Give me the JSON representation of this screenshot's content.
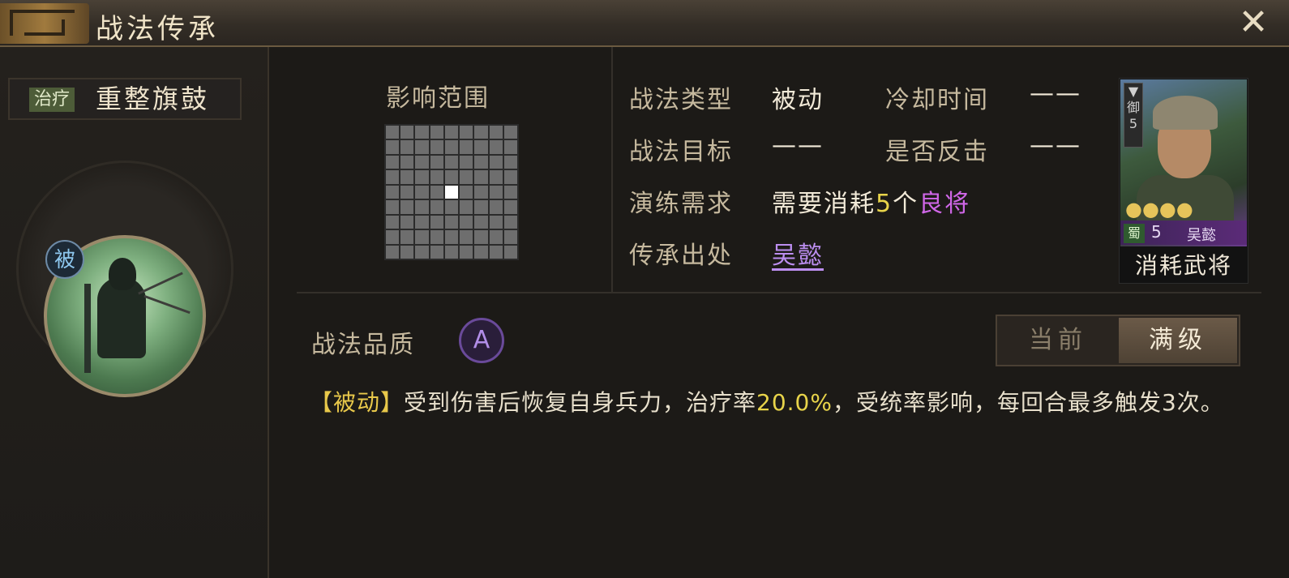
{
  "header": {
    "title": "战法传承",
    "close_icon": "close-icon"
  },
  "skill": {
    "tag": "治疗",
    "name": "重整旗鼓",
    "badge": "被"
  },
  "range": {
    "label": "影响范围",
    "grid_rows": 9,
    "grid_cols": 9,
    "highlight_row": 4,
    "highlight_col": 4
  },
  "info": {
    "type_label": "战法类型",
    "type_value": "被动",
    "cooldown_label": "冷却时间",
    "cooldown_value": "——",
    "target_label": "战法目标",
    "target_value": "——",
    "counter_label": "是否反击",
    "counter_value": "——",
    "req_label": "演练需求",
    "req_prefix": "需要消耗",
    "req_count": "5",
    "req_unit": "个",
    "req_item": "良将",
    "origin_label": "传承出处",
    "origin_value": "吴懿"
  },
  "card": {
    "rank_char": "御",
    "rank_num": "5",
    "stars": "CCCC",
    "faction": "蜀",
    "cost": "5",
    "name": "吴懿",
    "caption": "消耗武将"
  },
  "quality": {
    "label": "战法品质",
    "grade": "A"
  },
  "toggle": {
    "current": "当前",
    "max": "满级",
    "selected": "满级"
  },
  "description": {
    "tag": "【被动】",
    "part1": "受到伤害后恢复自身兵力，治疗率",
    "percent": "20.0%",
    "part2": "，受统率影响，每回合最多触发3次。"
  },
  "colors": {
    "accent_yellow": "#e8d44a",
    "accent_purple": "#d067e8",
    "link": "#bc8ef0",
    "tag_green": "#4d5c38"
  }
}
